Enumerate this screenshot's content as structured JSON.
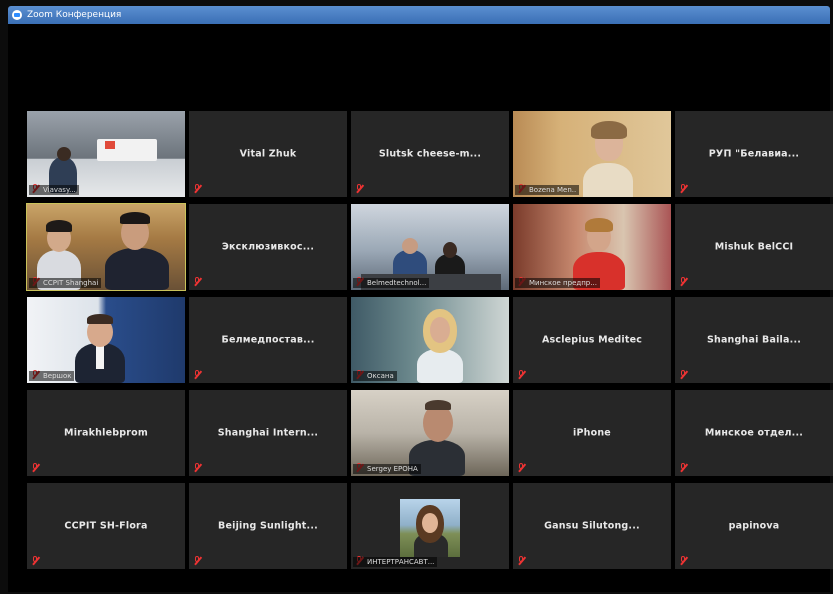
{
  "window": {
    "title": "Zoom Конференция"
  },
  "participants": [
    {
      "name": "Viavasy...",
      "type": "video",
      "scene": "room"
    },
    {
      "name": "Vital Zhuk",
      "type": "name"
    },
    {
      "name": "Slutsk cheese-m...",
      "type": "name"
    },
    {
      "name": "Bozena Men..",
      "type": "video",
      "scene": "woman1"
    },
    {
      "name": "РУП \"Белавиа...",
      "type": "name"
    },
    {
      "name": "CCPIT Shanghai",
      "type": "video",
      "scene": "cc",
      "active": true
    },
    {
      "name": "Эксклюзивкос...",
      "type": "name"
    },
    {
      "name": "Belmedtechnol...",
      "type": "video",
      "scene": "meet"
    },
    {
      "name": "Минское предпр...",
      "type": "video",
      "scene": "red"
    },
    {
      "name": "Mishuk BelCCI",
      "type": "name"
    },
    {
      "name": "Вершок",
      "type": "video",
      "scene": "office"
    },
    {
      "name": "Белмедпостав...",
      "type": "name"
    },
    {
      "name": "Оксана",
      "type": "video",
      "scene": "blonde"
    },
    {
      "name": "Asclepius Meditec",
      "type": "name"
    },
    {
      "name": "Shanghai Baila...",
      "type": "name"
    },
    {
      "name": "Mirakhlebprom",
      "type": "name"
    },
    {
      "name": "Shanghai Intern...",
      "type": "name"
    },
    {
      "name": "Sergey EPOHA",
      "type": "video",
      "scene": "man"
    },
    {
      "name": "iPhone",
      "type": "name"
    },
    {
      "name": "Минское отдел...",
      "type": "name"
    },
    {
      "name": "CCPIT SH-Flora",
      "type": "name"
    },
    {
      "name": "Beijing Sunlight...",
      "type": "name"
    },
    {
      "name": "ИНТЕРТРАНСАВТ...",
      "type": "video",
      "scene": "pip"
    },
    {
      "name": "Gansu Silutong...",
      "type": "name"
    },
    {
      "name": "papinova",
      "type": "name"
    }
  ]
}
